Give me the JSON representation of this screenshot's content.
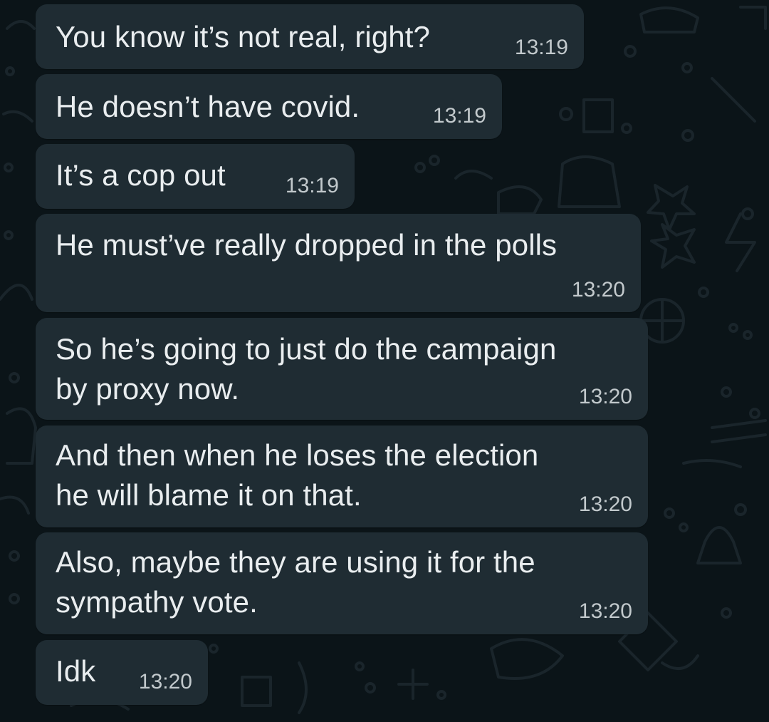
{
  "messages": [
    {
      "text": "You know it’s not real, right?",
      "time": "13:19"
    },
    {
      "text": "He doesn’t have covid.",
      "time": "13:19"
    },
    {
      "text": "It’s a cop out",
      "time": "13:19"
    },
    {
      "text": "He must’ve really dropped in the polls",
      "time": "13:20"
    },
    {
      "text_lines": [
        "So he’s going to just do the campaign",
        "by proxy now."
      ],
      "time": "13:20"
    },
    {
      "text_lines": [
        "And then when he loses the election",
        "he will blame it on that."
      ],
      "time": "13:20"
    },
    {
      "text_lines": [
        "Also, maybe they are using it for the",
        "sympathy vote."
      ],
      "time": "13:20"
    },
    {
      "text": "Idk",
      "time": "13:20"
    }
  ],
  "colors": {
    "background": "#0b1418",
    "bubble": "#1f2c33",
    "text": "#e9edef",
    "timestamp": "#c2c9cc",
    "wallpaper_doodle": "#1a252b"
  }
}
